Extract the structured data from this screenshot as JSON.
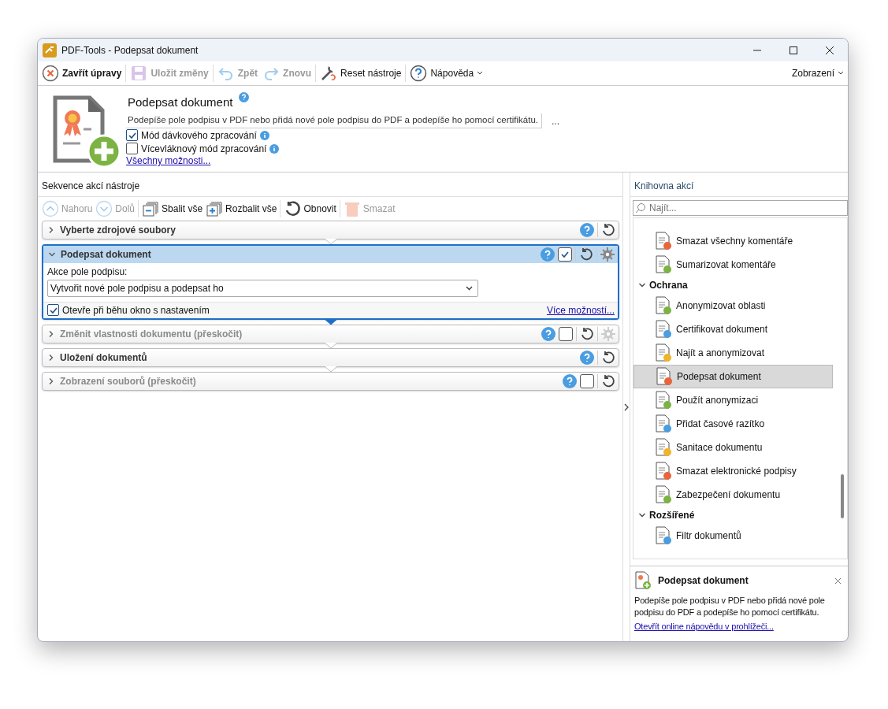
{
  "window": {
    "title": "PDF-Tools - Podepsat dokument"
  },
  "toolbar": [
    {
      "label": "Zavřít úpravy",
      "kind": "close",
      "disabled": false
    },
    {
      "label": "Uložit změny",
      "kind": "save",
      "disabled": true
    },
    {
      "label": "Zpět",
      "kind": "undo",
      "disabled": true
    },
    {
      "label": "Znovu",
      "kind": "redo",
      "disabled": true
    },
    {
      "label": "Reset nástroje",
      "kind": "reset",
      "disabled": false
    },
    {
      "label": "Nápověda",
      "kind": "help",
      "disabled": false
    }
  ],
  "view_menu": "Zobrazení",
  "tool": {
    "title": "Podepsat dokument",
    "description": "Podepíše pole podpisu v PDF nebo přidá nové pole podpisu do PDF a podepíše ho pomocí certifikátu.",
    "more": "...",
    "options": [
      {
        "label": "Mód dávkového zpracování",
        "checked": true
      },
      {
        "label": "Vícevláknový mód zpracování",
        "checked": false
      }
    ],
    "all_options_link": "Všechny možnosti..."
  },
  "sequence": {
    "title": "Sekvence akcí nástroje",
    "toolbar": [
      {
        "label": "Nahoru",
        "kind": "up",
        "disabled": true
      },
      {
        "label": "Dolů",
        "kind": "down",
        "disabled": true
      },
      {
        "label": "Sbalit vše",
        "kind": "collapse",
        "disabled": false
      },
      {
        "label": "Rozbalit vše",
        "kind": "expand",
        "disabled": false
      },
      {
        "label": "Obnovit",
        "kind": "refresh",
        "disabled": false
      },
      {
        "label": "Smazat",
        "kind": "delete",
        "disabled": true
      }
    ],
    "steps": [
      {
        "title": "Vyberte zdrojové soubory",
        "expanded": false,
        "skipped": false,
        "selected": false
      },
      {
        "title": "Podepsat dokument",
        "expanded": true,
        "skipped": false,
        "selected": true,
        "checked": true,
        "settings_enabled": true,
        "field_label": "Akce pole podpisu:",
        "select_value": "Vytvořit nové pole podpisu a podepsat ho",
        "open_settings": {
          "label": "Otevře při běhu okno s nastavením",
          "checked": true
        },
        "more_link": "Více možností..."
      },
      {
        "title": "Změnit vlastnosti dokumentu (přeskočit)",
        "expanded": false,
        "skipped": true,
        "selected": false,
        "checked": false,
        "settings_enabled": false
      },
      {
        "title": "Uložení dokumentů",
        "expanded": false,
        "skipped": false,
        "selected": false
      },
      {
        "title": "Zobrazení souborů (přeskočit)",
        "expanded": false,
        "skipped": true,
        "selected": false,
        "checked": false
      }
    ]
  },
  "library": {
    "title": "Knihovna akcí",
    "search": {
      "placeholder": "Najít..."
    },
    "groups": [
      {
        "items": [
          {
            "label": "Smazat všechny komentáře",
            "selected": false
          },
          {
            "label": "Sumarizovat komentáře",
            "selected": false
          }
        ]
      },
      {
        "name": "Ochrana",
        "expanded": true,
        "items": [
          {
            "label": "Anonymizovat oblasti",
            "selected": false
          },
          {
            "label": "Certifikovat dokument",
            "selected": false
          },
          {
            "label": "Najít a anonymizovat",
            "selected": false
          },
          {
            "label": "Podepsat dokument",
            "selected": true
          },
          {
            "label": "Použít anonymizaci",
            "selected": false
          },
          {
            "label": "Přidat časové razítko",
            "selected": false
          },
          {
            "label": "Sanitace dokumentu",
            "selected": false
          },
          {
            "label": "Smazat elektronické podpisy",
            "selected": false
          },
          {
            "label": "Zabezpečení dokumentu",
            "selected": false
          }
        ]
      },
      {
        "name": "Rozšířené",
        "expanded": true,
        "items": [
          {
            "label": "Filtr dokumentů",
            "selected": false
          }
        ]
      }
    ]
  },
  "info": {
    "title": "Podepsat dokument",
    "description": "Podepíše pole podpisu v PDF nebo přidá nové pole podpisu do PDF a podepíše ho pomocí certifikátu.",
    "link": "Otevřít online nápovědu v prohlížeči..."
  }
}
